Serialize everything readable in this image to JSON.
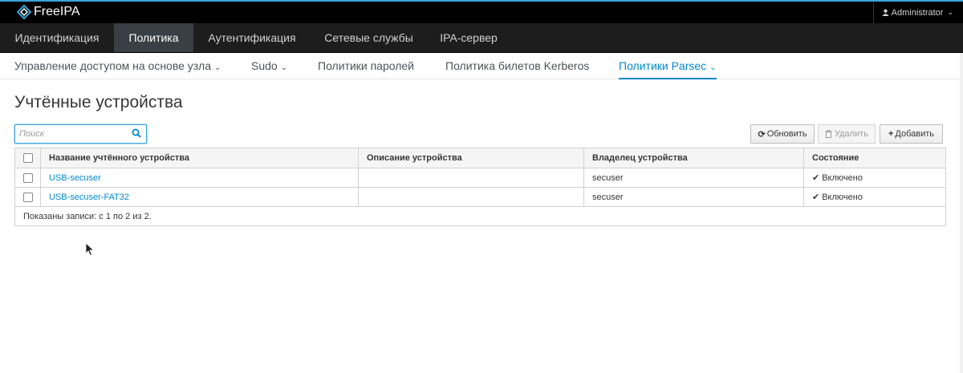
{
  "app": {
    "name": "FreeIPA",
    "user": "Administrator"
  },
  "nav_primary": [
    {
      "label": "Идентификация"
    },
    {
      "label": "Политика"
    },
    {
      "label": "Аутентификация"
    },
    {
      "label": "Сетевые службы"
    },
    {
      "label": "IPA-сервер"
    }
  ],
  "nav_primary_active": "Политика",
  "nav_secondary": [
    {
      "label": "Управление доступом на основе узла",
      "has_dropdown": true
    },
    {
      "label": "Sudo",
      "has_dropdown": true
    },
    {
      "label": "Политики паролей",
      "has_dropdown": false
    },
    {
      "label": "Политика билетов Kerberos",
      "has_dropdown": false
    },
    {
      "label": "Политики Parsec",
      "has_dropdown": true
    }
  ],
  "nav_secondary_active": "Политики Parsec",
  "page": {
    "title": "Учтённые устройства"
  },
  "search": {
    "placeholder": "Поиск",
    "value": ""
  },
  "actions": {
    "refresh": "Обновить",
    "delete": "Удалить",
    "add": "Добавить"
  },
  "table": {
    "columns": [
      "Название учтённого устройства",
      "Описание устройства",
      "Владелец устройства",
      "Состояние"
    ],
    "rows": [
      {
        "name": "USB-secuser",
        "description": "",
        "owner": "secuser",
        "state": "Включено"
      },
      {
        "name": "USB-secuser-FAT32",
        "description": "",
        "owner": "secuser",
        "state": "Включено"
      }
    ],
    "footer": "Показаны записи: с 1 по 2 из 2."
  },
  "colors": {
    "accent": "#0088ce",
    "header_bg": "#000000",
    "nav_bg": "#1d1d1d",
    "nav_active_bg": "#393f44"
  },
  "icons": [
    "freeipa-logo",
    "user-icon",
    "chevron-down-icon",
    "search-icon",
    "refresh-icon",
    "trash-icon",
    "plus-icon",
    "check-icon",
    "mouse-cursor"
  ]
}
